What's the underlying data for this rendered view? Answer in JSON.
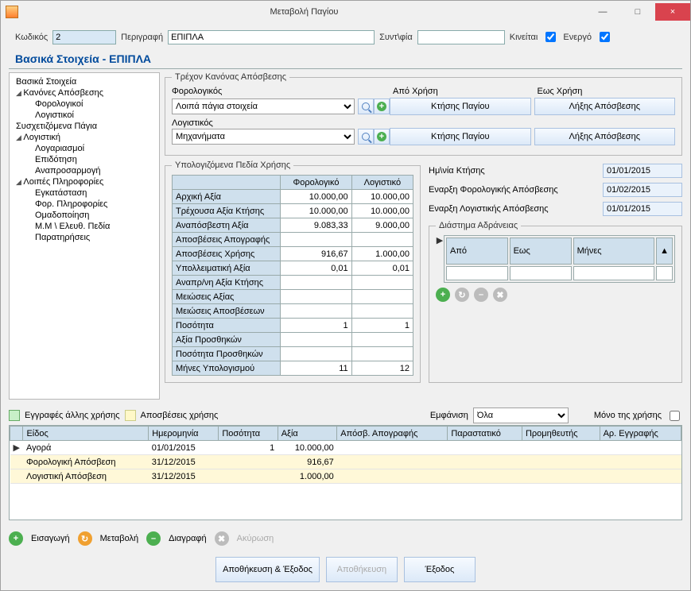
{
  "window": {
    "title": "Μεταβολή Παγίου"
  },
  "winbtns": {
    "min": "—",
    "max": "□",
    "close": "×"
  },
  "topform": {
    "kodikos_label": "Κωδικός",
    "kodikos_value": "2",
    "perigrafi_label": "Περιγραφή",
    "perigrafi_value": "ΕΠΙΠΛΑ",
    "syntfia_label": "Συντ\\φία",
    "syntfia_value": "",
    "kineitai_label": "Κινείται",
    "energo_label": "Ενεργό"
  },
  "section_title": "Βασικά Στοιχεία - ΕΠΙΠΛΑ",
  "tree": {
    "n0": "Βασικά Στοιχεία",
    "n1": "Κανόνες Απόσβεσης",
    "n1a": "Φορολογικοί",
    "n1b": "Λογιστικοί",
    "n2": "Συσχετιζόμενα Πάγια",
    "n3": "Λογιστική",
    "n3a": "Λογαριασμοί",
    "n3b": "Επιδότηση",
    "n3c": "Αναπροσαρμογή",
    "n4": "Λοιπές Πληροφορίες",
    "n4a": "Εγκατάσταση",
    "n4b": "Φορ. Πληροφορίες",
    "n4c": "Ομαδοποίηση",
    "n4d": "Μ.Μ \\ Ελευθ. Πεδία",
    "n4e": "Παρατηρήσεις"
  },
  "rules": {
    "legend": "Τρέχον Κανόνας Απόσβεσης",
    "for_label": "Φορολογικός",
    "log_label": "Λογιστικός",
    "apo_label": "Από Χρήση",
    "eos_label": "Εως Χρήση",
    "for_value": "Λοιπά πάγια στοιχεία",
    "log_value": "Μηχανήματα",
    "btn_ktisis": "Κτήσης Παγίου",
    "btn_lixis": "Λήξης Απόσβεσης"
  },
  "calc": {
    "legend": "Υπολογιζόμενα Πεδία Χρήσης",
    "col_for": "Φορολογικό",
    "col_log": "Λογιστικό",
    "rows": [
      {
        "l": "Αρχική Αξία",
        "f": "10.000,00",
        "g": "10.000,00"
      },
      {
        "l": "Τρέχουσα Αξία Κτήσης",
        "f": "10.000,00",
        "g": "10.000,00"
      },
      {
        "l": "Αναπόσβεστη Αξία",
        "f": "9.083,33",
        "g": "9.000,00"
      },
      {
        "l": "Αποσβέσεις Απογραφής",
        "f": "",
        "g": ""
      },
      {
        "l": "Αποσβέσεις Χρήσης",
        "f": "916,67",
        "g": "1.000,00"
      },
      {
        "l": "Υπολλειματική Αξία",
        "f": "0,01",
        "g": "0,01"
      },
      {
        "l": "Αναπρ/νη Αξία Κτήσης",
        "f": "",
        "g": ""
      },
      {
        "l": "Μειώσεις Αξίας",
        "f": "",
        "g": ""
      },
      {
        "l": "Μειώσεις Αποσβέσεων",
        "f": "",
        "g": ""
      },
      {
        "l": "Ποσότητα",
        "f": "1",
        "g": "1"
      },
      {
        "l": "Αξία Προσθηκών",
        "f": "",
        "g": ""
      },
      {
        "l": "Ποσότητα Προσθηκών",
        "f": "",
        "g": ""
      },
      {
        "l": "Μήνες Υπολογισμού",
        "f": "11",
        "g": "12"
      }
    ]
  },
  "dates": {
    "d1_label": "Ημ\\νία Κτήσης",
    "d1": "01/01/2015",
    "d2_label": "Εναρξη Φορολογικής  Απόσβεσης",
    "d2": "01/02/2015",
    "d3_label": "Εναρξη Λογιστικής Απόσβεσης",
    "d3": "01/01/2015"
  },
  "idle": {
    "legend": "Διάστημα Αδράνειας",
    "c1": "Από",
    "c2": "Εως",
    "c3": "Μήνες"
  },
  "filter": {
    "leg_other": "Εγγραφές άλλης χρήσης",
    "leg_apo": "Αποσβέσεις χρήσης",
    "emfanisi_label": "Εμφάνιση",
    "emfanisi_value": "Όλα",
    "mono_label": "Μόνο της χρήσης"
  },
  "grid": {
    "h1": "Είδος",
    "h2": "Ημερομηνία",
    "h3": "Ποσότητα",
    "h4": "Αξία",
    "h5": "Απόσβ. Απογραφής",
    "h6": "Παραστατικό",
    "h7": "Προμηθευτής",
    "h8": "Αρ. Εγγραφής",
    "rows": [
      {
        "c1": "Αγορά",
        "c2": "01/01/2015",
        "c3": "1",
        "c4": "10.000,00",
        "yellow": false
      },
      {
        "c1": "Φορολογική Απόσβεση",
        "c2": "31/12/2015",
        "c3": "",
        "c4": "916,67",
        "yellow": true
      },
      {
        "c1": "Λογιστική Απόσβεση",
        "c2": "31/12/2015",
        "c3": "",
        "c4": "1.000,00",
        "yellow": true
      }
    ]
  },
  "actions": {
    "ins": "Εισαγωγή",
    "mod": "Μεταβολή",
    "del": "Διαγραφή",
    "cancel": "Ακύρωση"
  },
  "footer": {
    "save_exit": "Αποθήκευση & Έξοδος",
    "save": "Αποθήκευση",
    "exit": "Έξοδος"
  }
}
